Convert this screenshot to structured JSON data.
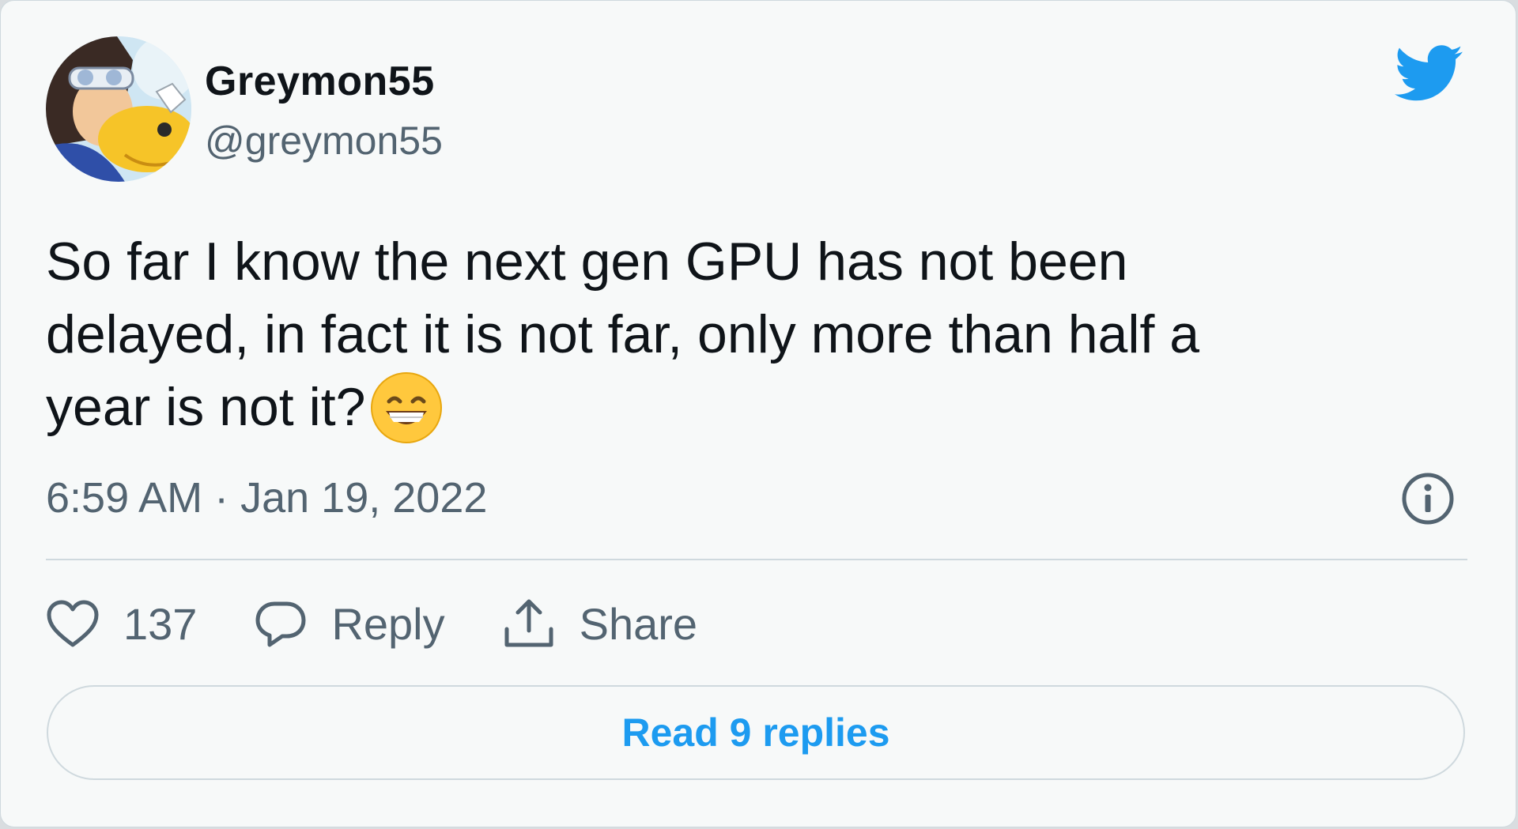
{
  "author": {
    "display_name": "Greymon55",
    "handle": "@greymon55",
    "avatar_icon": "avatar-image"
  },
  "brand": {
    "logo_icon": "twitter-bird-icon",
    "color": "#1d9bf0"
  },
  "tweet": {
    "text": "So far I know the next gen GPU has not been\ndelayed, in fact it is not far, only more than half a\nyear is not it?",
    "emoji": "grinning-face-with-smiling-eyes",
    "timestamp": "6:59 AM · Jan 19, 2022"
  },
  "actions": {
    "like_count": "137",
    "reply_label": "Reply",
    "share_label": "Share"
  },
  "read_replies_label": "Read 9 replies",
  "info_icon": "info-circle-icon"
}
